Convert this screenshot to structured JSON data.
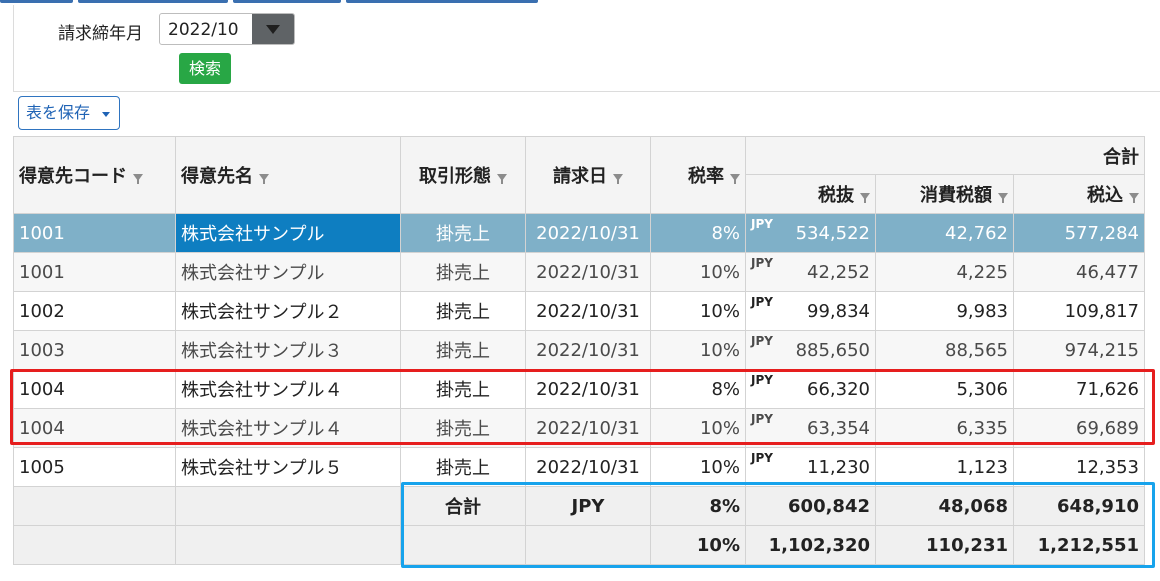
{
  "filter": {
    "label": "請求締年月",
    "year_month_value": "2022/10",
    "search_label": "検索"
  },
  "toolbar": {
    "save_label": "表を保存"
  },
  "table": {
    "headers": {
      "code": "得意先コード",
      "name": "得意先名",
      "type": "取引形態",
      "date": "請求日",
      "rate": "税率",
      "total_group": "合計",
      "excl": "税抜",
      "tax": "消費税額",
      "incl": "税込"
    },
    "rows": [
      {
        "code": "1001",
        "name": "株式会社サンプル",
        "type": "掛売上",
        "date": "2022/10/31",
        "rate": "8%",
        "currency": "JPY",
        "excl": "534,522",
        "tax": "42,762",
        "incl": "577,284",
        "state": "selected"
      },
      {
        "code": "1001",
        "name": "株式会社サンプル",
        "type": "掛売上",
        "date": "2022/10/31",
        "rate": "10%",
        "currency": "JPY",
        "excl": "42,252",
        "tax": "4,225",
        "incl": "46,477",
        "state": "alt"
      },
      {
        "code": "1002",
        "name": "株式会社サンプル２",
        "type": "掛売上",
        "date": "2022/10/31",
        "rate": "10%",
        "currency": "JPY",
        "excl": "99,834",
        "tax": "9,983",
        "incl": "109,817",
        "state": "plain"
      },
      {
        "code": "1003",
        "name": "株式会社サンプル３",
        "type": "掛売上",
        "date": "2022/10/31",
        "rate": "10%",
        "currency": "JPY",
        "excl": "885,650",
        "tax": "88,565",
        "incl": "974,215",
        "state": "alt"
      },
      {
        "code": "1004",
        "name": "株式会社サンプル４",
        "type": "掛売上",
        "date": "2022/10/31",
        "rate": "8%",
        "currency": "JPY",
        "excl": "66,320",
        "tax": "5,306",
        "incl": "71,626",
        "state": "plain"
      },
      {
        "code": "1004",
        "name": "株式会社サンプル４",
        "type": "掛売上",
        "date": "2022/10/31",
        "rate": "10%",
        "currency": "JPY",
        "excl": "63,354",
        "tax": "6,335",
        "incl": "69,689",
        "state": "alt"
      },
      {
        "code": "1005",
        "name": "株式会社サンプル５",
        "type": "掛売上",
        "date": "2022/10/31",
        "rate": "10%",
        "currency": "JPY",
        "excl": "11,230",
        "tax": "1,123",
        "incl": "12,353",
        "state": "plain"
      }
    ],
    "footer": [
      {
        "label": "合計",
        "currency": "JPY",
        "rate": "8%",
        "excl": "600,842",
        "tax": "48,068",
        "incl": "648,910"
      },
      {
        "label": "",
        "currency": "",
        "rate": "10%",
        "excl": "1,102,320",
        "tax": "110,231",
        "incl": "1,212,551"
      }
    ]
  },
  "colors": {
    "accent_blue": "#1f63b5",
    "search_green": "#28a745",
    "selected_row": "#7fb0c8",
    "selected_cell": "#0e7ec1",
    "highlight_red": "#e61e1e",
    "highlight_blue": "#17a3ec"
  }
}
